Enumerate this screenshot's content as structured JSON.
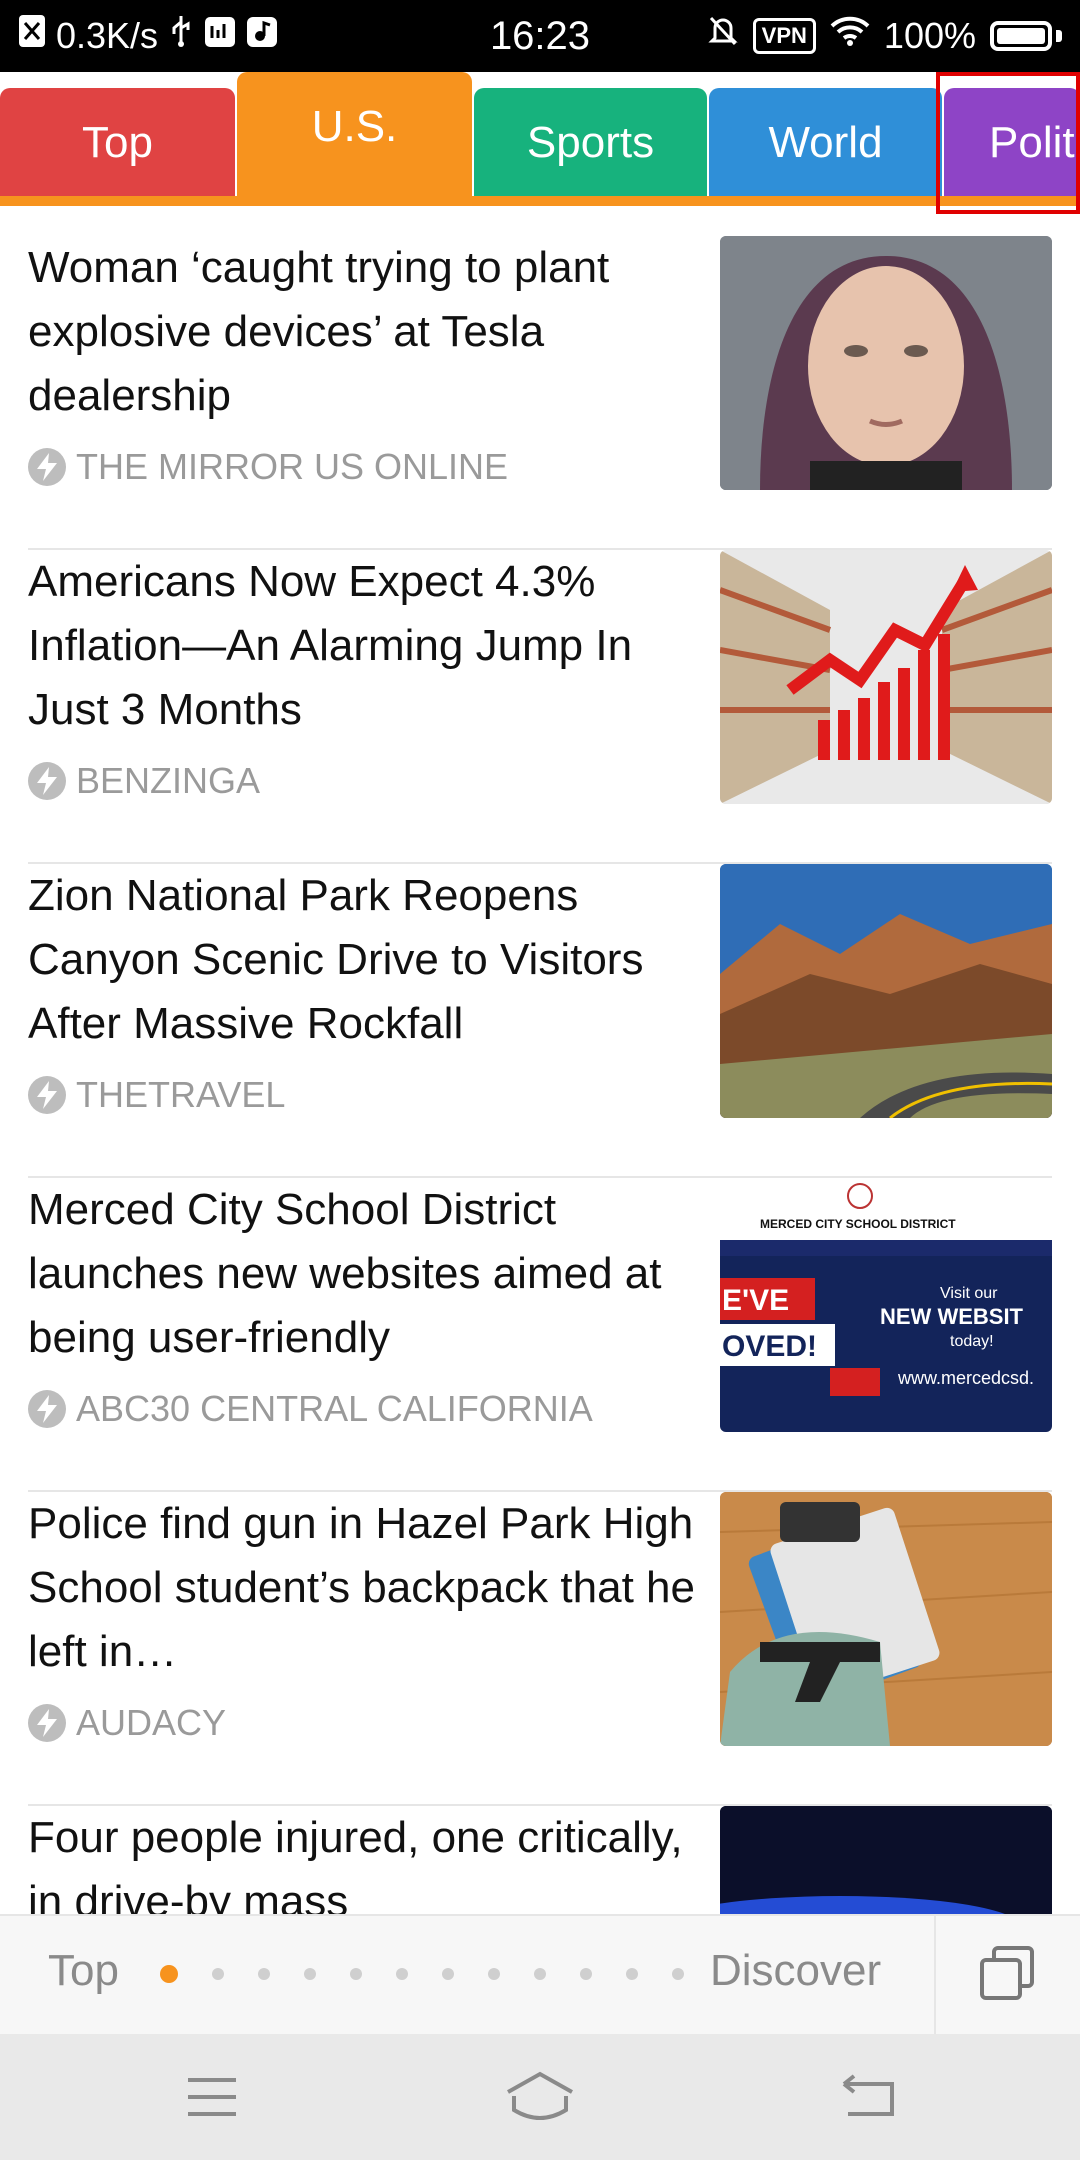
{
  "status_bar": {
    "speed": "0.3K/s",
    "time": "16:23",
    "vpn": "VPN",
    "battery": "100%"
  },
  "tabs": [
    {
      "label": "Top",
      "color": "#e04343"
    },
    {
      "label": "U.S.",
      "color": "#f7931e"
    },
    {
      "label": "Sports",
      "color": "#17b27d"
    },
    {
      "label": "World",
      "color": "#2f8fd8"
    },
    {
      "label": "Polit",
      "color": "#8e44c6"
    }
  ],
  "articles": [
    {
      "headline": "Woman ‘caught trying to plant explosive devices’ at Tesla dealership",
      "source": "THE MIRROR US ONLINE"
    },
    {
      "headline": "Americans Now Expect 4.3% Inflation—An Alarming Jump In Just 3 Months",
      "source": "BENZINGA"
    },
    {
      "headline": "Zion National Park Reopens Canyon Scenic Drive to Visitors After Massive Rockfall",
      "source": "THETRAVEL"
    },
    {
      "headline": "Merced City School District launches new websites aimed at being user-friendly",
      "source": "ABC30 CENTRAL CALIFORNIA"
    },
    {
      "headline": "Police find gun in Hazel Park High School student’s backpack that he left in…",
      "source": "AUDACY"
    },
    {
      "headline": "Four people injured, one critically, in drive-by mass",
      "source": ""
    }
  ],
  "thumb_text": {
    "merced_title": "MERCED CITY SCHOOL DISTRICT",
    "weve": "E'VE",
    "moved": "OVED!",
    "visit_our": "Visit our",
    "new_website": "NEW WEBSIT",
    "today": "today!",
    "url": "www.mercedcsd."
  },
  "pager": {
    "left_label": "Top",
    "right_label": "Discover",
    "dot_count": 12,
    "active_dot": 0
  },
  "colors": {
    "accent": "#f7931e",
    "highlight": "#e00000"
  }
}
